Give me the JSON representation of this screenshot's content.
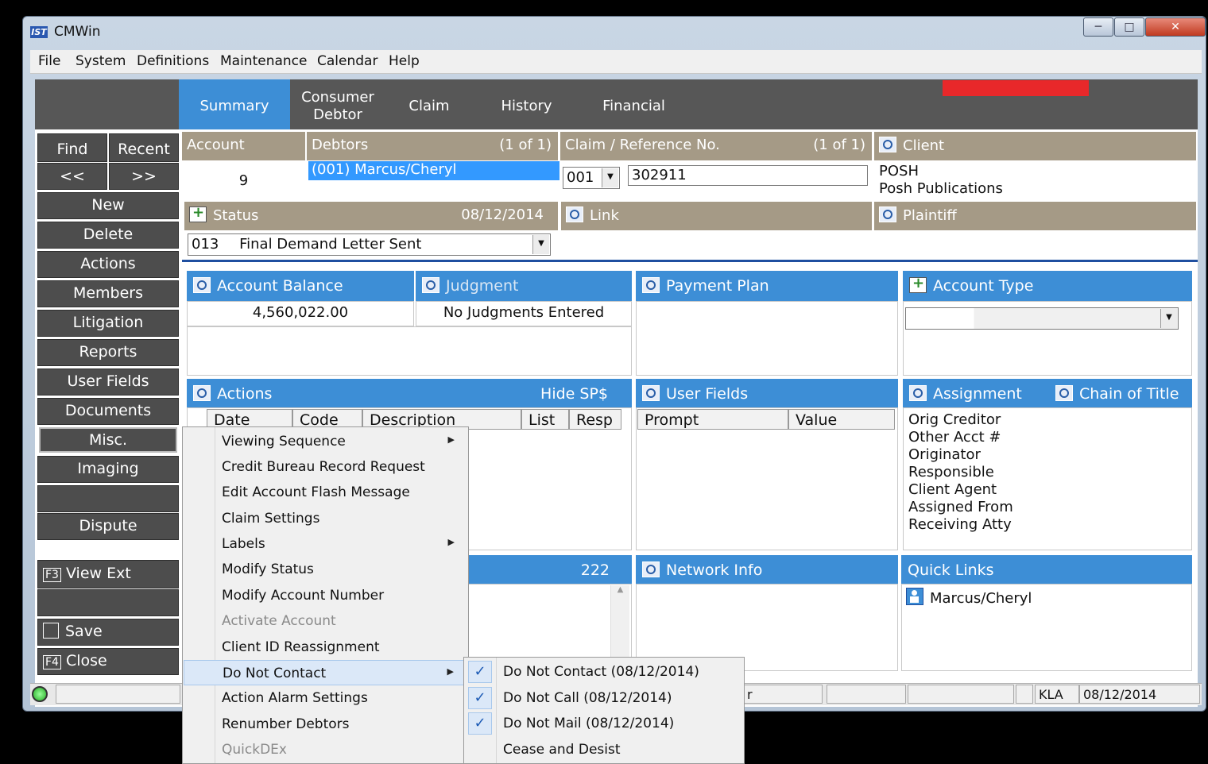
{
  "window": {
    "title": "CMWin",
    "app_icon": "IST"
  },
  "menubar": [
    "File",
    "System",
    "Definitions",
    "Maintenance",
    "Calendar",
    "Help"
  ],
  "tabs": [
    {
      "label": "Summary",
      "active": true
    },
    {
      "label": "Consumer\nDebtor"
    },
    {
      "label": "Claim"
    },
    {
      "label": "History"
    },
    {
      "label": "Financial"
    }
  ],
  "nav": {
    "find": "Find",
    "recent": "Recent",
    "prev": "<<",
    "next": ">>",
    "items": [
      "New",
      "Delete",
      "Actions",
      "Members",
      "Litigation",
      "Reports",
      "User Fields",
      "Documents",
      "Misc.",
      "Imaging",
      "",
      "Dispute"
    ],
    "view_ext": "View Ext",
    "view_ext_key": "F3",
    "save": "Save",
    "close": "Close",
    "close_key": "F4"
  },
  "account": {
    "label": "Account",
    "value": "9"
  },
  "debtors": {
    "label": "Debtors",
    "count": "(1 of 1)",
    "selected": "(001) Marcus/Cheryl"
  },
  "claim": {
    "label": "Claim / Reference No.",
    "count": "(1 of 1)",
    "num": "001",
    "ref": "302911"
  },
  "client": {
    "label": "Client",
    "code": "POSH",
    "name": "Posh Publications"
  },
  "status": {
    "label": "Status",
    "date": "08/12/2014",
    "code": "013",
    "text": "Final Demand Letter Sent"
  },
  "link": {
    "label": "Link"
  },
  "plaintiff": {
    "label": "Plaintiff"
  },
  "account_balance": {
    "label": "Account Balance",
    "value": "4,560,022.00"
  },
  "judgment": {
    "label": "Judgment",
    "value": "No Judgments Entered"
  },
  "payment_plan": {
    "label": "Payment Plan"
  },
  "account_type": {
    "label": "Account Type",
    "value": ""
  },
  "actions_panel": {
    "label": "Actions",
    "hide": "Hide SP$",
    "columns": [
      "Date",
      "Code",
      "Description",
      "List",
      "Resp"
    ]
  },
  "user_fields": {
    "label": "User Fields",
    "columns": [
      "Prompt",
      "Value"
    ]
  },
  "assignment": {
    "label": "Assignment",
    "chain_label": "Chain of Title",
    "items": [
      "Orig Creditor",
      "Other Acct #",
      "Originator",
      "Responsible",
      "Client Agent",
      "Assigned From",
      "Receiving Atty"
    ]
  },
  "notes_count": "222",
  "network_info": {
    "label": "Network Info"
  },
  "quick_links": {
    "label": "Quick Links",
    "items": [
      "Marcus/Cheryl"
    ]
  },
  "context_menu": {
    "items": [
      {
        "label": "Viewing Sequence",
        "submenu": true
      },
      {
        "label": "Credit Bureau Record Request"
      },
      {
        "label": "Edit Account Flash Message"
      },
      {
        "label": "Claim Settings"
      },
      {
        "label": "Labels",
        "submenu": true
      },
      {
        "label": "Modify Status"
      },
      {
        "label": "Modify Account Number"
      },
      {
        "label": "Activate Account",
        "disabled": true
      },
      {
        "label": "Client ID Reassignment"
      },
      {
        "label": "Do Not Contact",
        "submenu": true,
        "highlight": true
      },
      {
        "label": "Action Alarm Settings"
      },
      {
        "label": "Renumber Debtors"
      },
      {
        "label": "QuickDEx",
        "disabled": true
      }
    ]
  },
  "submenu": {
    "items": [
      {
        "label": "Do Not Contact (08/12/2014)",
        "checked": true
      },
      {
        "label": "Do Not Call (08/12/2014)",
        "checked": true
      },
      {
        "label": "Do Not Mail (08/12/2014)",
        "checked": true
      },
      {
        "label": "Cease and Desist",
        "checked": false
      }
    ]
  },
  "statusbar": {
    "partial": "r",
    "user": "KLA",
    "date": "08/12/2014"
  },
  "colors": {
    "tab_active": "#3d8ed6",
    "section_blue": "#3d8ed6",
    "section_tan": "#a59a86",
    "nav_dark": "#4d4d4d"
  }
}
